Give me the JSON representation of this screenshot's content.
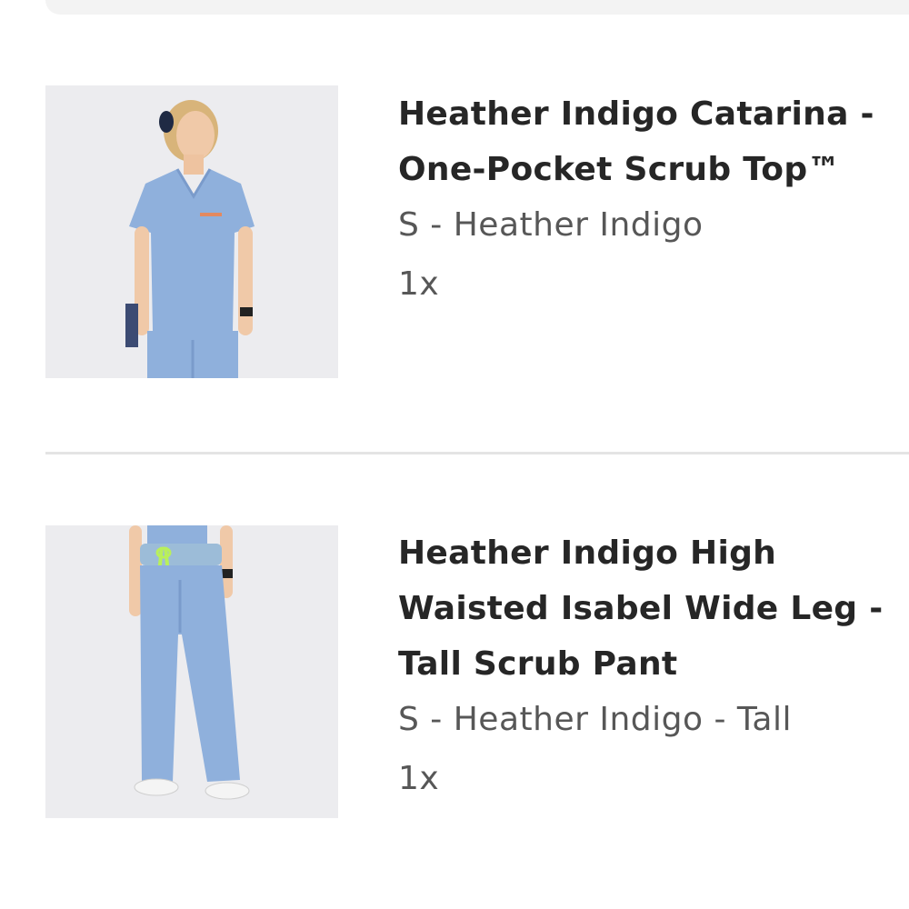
{
  "cart": {
    "items": [
      {
        "title": "Heather Indigo Catarina - One-Pocket Scrub Top™",
        "variant": "S - Heather Indigo",
        "quantity": "1x",
        "image": "scrub-top-model-photo"
      },
      {
        "title": "Heather Indigo High Waisted Isabel Wide Leg - Tall Scrub Pant",
        "variant": "S - Heather Indigo - Tall",
        "quantity": "1x",
        "image": "scrub-pant-model-photo"
      }
    ]
  },
  "colors": {
    "scrub": "#8fb0dc",
    "drawstring": "#b9f05a",
    "background": "#ececef"
  }
}
